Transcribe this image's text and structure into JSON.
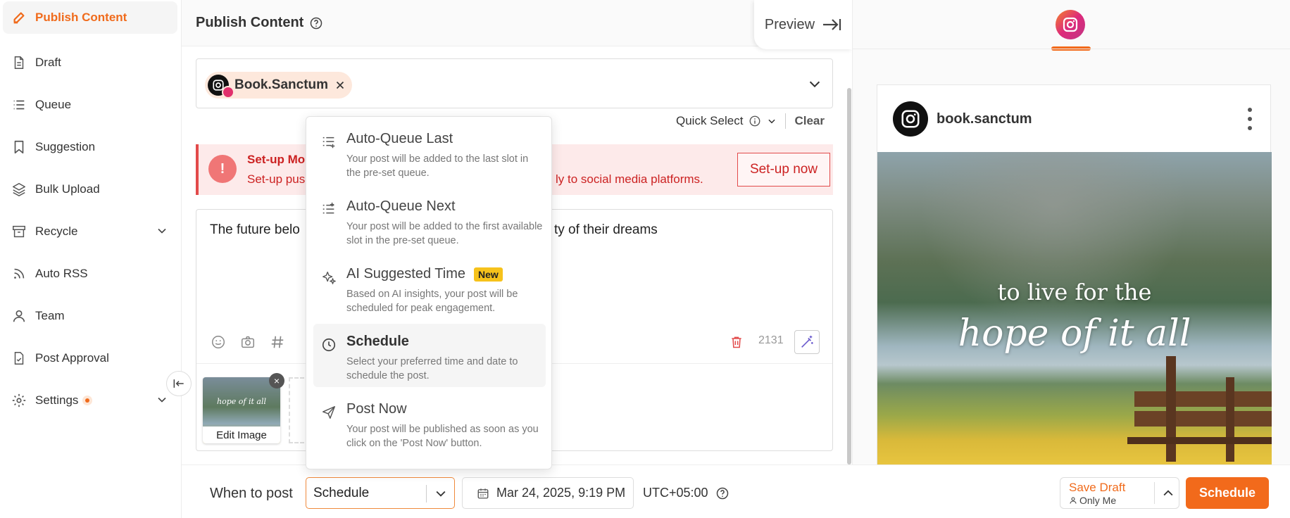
{
  "sidebar": {
    "items": [
      {
        "label": "Publish Content",
        "icon": "pen-icon"
      },
      {
        "label": "Draft",
        "icon": "document-icon"
      },
      {
        "label": "Queue",
        "icon": "list-icon"
      },
      {
        "label": "Suggestion",
        "icon": "bookmark-icon"
      },
      {
        "label": "Bulk Upload",
        "icon": "layers-icon"
      },
      {
        "label": "Recycle",
        "icon": "archive-icon"
      },
      {
        "label": "Auto RSS",
        "icon": "rss-icon"
      },
      {
        "label": "Team",
        "icon": "user-icon"
      },
      {
        "label": "Post Approval",
        "icon": "approval-icon"
      },
      {
        "label": "Settings",
        "icon": "gear-icon"
      }
    ]
  },
  "header": {
    "title": "Publish Content",
    "preview_label": "Preview"
  },
  "account": {
    "name": "Book.Sanctum"
  },
  "quick_select": {
    "label": "Quick Select",
    "clear_label": "Clear"
  },
  "alert": {
    "title": "Set-up Mo",
    "text_part1": "Set-up pus",
    "text_part2": "ly to social media platforms.",
    "button_label": "Set-up now"
  },
  "editor": {
    "text_part1": "The future belo",
    "text_part2": "ty of their dreams",
    "char_count": "2131",
    "edit_image_label": "Edit Image",
    "thumb_caption": "hope of it all"
  },
  "menu": {
    "items": [
      {
        "title": "Auto-Queue Last",
        "desc": "Your post will be added to the last slot in the pre-set queue."
      },
      {
        "title": "Auto-Queue Next",
        "desc": "Your post will be added to the first available slot in the pre-set queue."
      },
      {
        "title": "AI Suggested Time",
        "badge": "New",
        "desc": "Based on AI insights, your post will be scheduled for peak engagement."
      },
      {
        "title": "Schedule",
        "desc": "Select your preferred time and date to schedule the post."
      },
      {
        "title": "Post Now",
        "desc": "Your post will be published as soon as you click on the 'Post Now' button."
      }
    ]
  },
  "bottom": {
    "when_label": "When to post",
    "when_value": "Schedule",
    "date_value": "Mar 24, 2025, 9:19 PM",
    "timezone": "UTC+05:00",
    "save_draft_label": "Save Draft",
    "save_draft_sub": "Only Me",
    "schedule_label": "Schedule"
  },
  "preview": {
    "username": "book.sanctum",
    "caption_line1": "to live for the",
    "caption_line2": "hope of it all"
  },
  "colors": {
    "accent": "#f26a1b",
    "alert": "#e24a4a",
    "badge": "#f6c21b"
  }
}
